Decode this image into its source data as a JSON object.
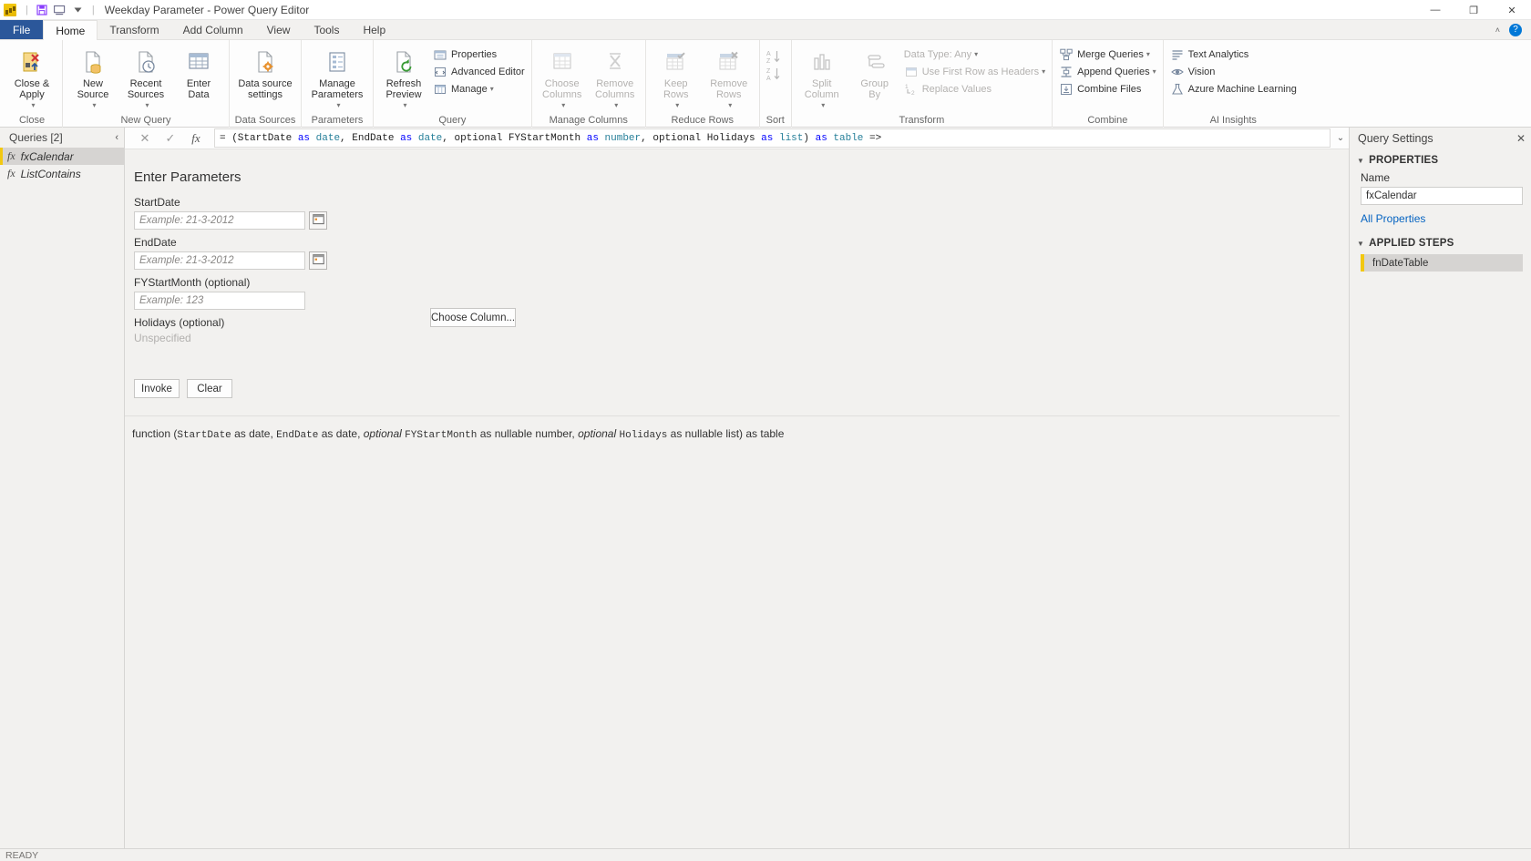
{
  "window": {
    "title": "Weekday Parameter - Power Query Editor",
    "minimize": "—",
    "maximize": "❐",
    "close": "✕",
    "qat_save": "save-icon",
    "qat_undo": "undo-icon",
    "qat_dropdown": "chevron-down-icon"
  },
  "tabs": [
    {
      "label": "File"
    },
    {
      "label": "Home"
    },
    {
      "label": "Transform"
    },
    {
      "label": "Add Column"
    },
    {
      "label": "View"
    },
    {
      "label": "Tools"
    },
    {
      "label": "Help"
    }
  ],
  "ribbon": {
    "collapse_caret": "˄",
    "help_label": "?",
    "groups": [
      {
        "name": "Close",
        "buttons": [
          {
            "label": "Close &\nApply",
            "caret": "▾"
          }
        ]
      },
      {
        "name": "New Query",
        "buttons": [
          {
            "label": "New\nSource",
            "caret": "▾"
          },
          {
            "label": "Recent\nSources",
            "caret": "▾"
          },
          {
            "label": "Enter\nData",
            "caret": ""
          }
        ]
      },
      {
        "name": "Data Sources",
        "buttons": [
          {
            "label": "Data source\nsettings",
            "caret": ""
          }
        ]
      },
      {
        "name": "Parameters",
        "buttons": [
          {
            "label": "Manage\nParameters",
            "caret": "▾"
          }
        ]
      },
      {
        "name": "Query",
        "buttons": [
          {
            "label": "Refresh\nPreview",
            "caret": "▾"
          }
        ],
        "small": [
          {
            "label": "Properties",
            "caret": ""
          },
          {
            "label": "Advanced Editor",
            "caret": ""
          },
          {
            "label": "Manage",
            "caret": "▾"
          }
        ]
      },
      {
        "name": "Manage Columns",
        "buttons": [
          {
            "label": "Choose\nColumns",
            "caret": "▾"
          },
          {
            "label": "Remove\nColumns",
            "caret": "▾"
          }
        ]
      },
      {
        "name": "Reduce Rows",
        "buttons": [
          {
            "label": "Keep\nRows",
            "caret": "▾"
          },
          {
            "label": "Remove\nRows",
            "caret": "▾"
          }
        ]
      },
      {
        "name": "Sort",
        "buttons": []
      },
      {
        "name": "Transform",
        "buttons": [
          {
            "label": "Split\nColumn",
            "caret": "▾"
          },
          {
            "label": "Group\nBy",
            "caret": ""
          }
        ],
        "small": [
          {
            "label": "Data Type: Any",
            "caret": "▾"
          },
          {
            "label": "Use First Row as Headers",
            "caret": "▾"
          },
          {
            "label": "Replace Values",
            "caret": ""
          }
        ]
      },
      {
        "name": "Combine",
        "small": [
          {
            "label": "Merge Queries",
            "caret": "▾"
          },
          {
            "label": "Append Queries",
            "caret": "▾"
          },
          {
            "label": "Combine Files",
            "caret": ""
          }
        ]
      },
      {
        "name": "AI Insights",
        "small": [
          {
            "label": "Text Analytics",
            "caret": ""
          },
          {
            "label": "Vision",
            "caret": ""
          },
          {
            "label": "Azure Machine Learning",
            "caret": ""
          }
        ]
      }
    ]
  },
  "queries": {
    "header": "Queries [2]",
    "collapse_icon": "‹",
    "items": [
      {
        "label": "fxCalendar",
        "icon": "fx"
      },
      {
        "label": "ListContains",
        "icon": "fx"
      }
    ]
  },
  "formula_bar": {
    "cancel_icon": "✕",
    "commit_icon": "✓",
    "fx_icon": "fx",
    "expand_icon": "⌄",
    "prefix": "= (StartDate ",
    "segments": [
      {
        "t": "= (StartDate ",
        "c": "plain"
      },
      {
        "t": "as",
        "c": "kw"
      },
      {
        "t": " ",
        "c": "plain"
      },
      {
        "t": "date",
        "c": "ty"
      },
      {
        "t": ", EndDate ",
        "c": "plain"
      },
      {
        "t": "as",
        "c": "kw"
      },
      {
        "t": " ",
        "c": "plain"
      },
      {
        "t": "date",
        "c": "ty"
      },
      {
        "t": ", optional FYStartMonth ",
        "c": "plain"
      },
      {
        "t": "as",
        "c": "kw"
      },
      {
        "t": " ",
        "c": "plain"
      },
      {
        "t": "number",
        "c": "ty"
      },
      {
        "t": ", optional Holidays ",
        "c": "plain"
      },
      {
        "t": "as",
        "c": "kw"
      },
      {
        "t": " ",
        "c": "plain"
      },
      {
        "t": "list",
        "c": "ty"
      },
      {
        "t": ") ",
        "c": "plain"
      },
      {
        "t": "as",
        "c": "kw"
      },
      {
        "t": " ",
        "c": "plain"
      },
      {
        "t": "table",
        "c": "ty"
      },
      {
        "t": " =>",
        "c": "plain"
      }
    ]
  },
  "invoke_form": {
    "title": "Enter Parameters",
    "fields": [
      {
        "label": "StartDate",
        "placeholder": "Example: 21-3-2012",
        "has_calendar": true
      },
      {
        "label": "EndDate",
        "placeholder": "Example: 21-3-2012",
        "has_calendar": true
      },
      {
        "label": "FYStartMonth (optional)",
        "placeholder": "Example: 123",
        "has_calendar": false
      }
    ],
    "holidays_label": "Holidays (optional)",
    "holidays_value": "Unspecified",
    "choose_column_button": "Choose Column...",
    "invoke_button": "Invoke",
    "clear_button": "Clear",
    "signature": {
      "pre": "function (",
      "p1": "StartDate",
      "s1": " as date, ",
      "p2": "EndDate",
      "s2": " as date, ",
      "opt1": "optional",
      "p3": "FYStartMonth",
      "s3": " as nullable number, ",
      "opt2": "optional",
      "p4": "Holidays",
      "s4": " as nullable list) as table"
    }
  },
  "query_settings": {
    "title": "Query Settings",
    "close_icon": "✕",
    "properties_header": "PROPERTIES",
    "name_label": "Name",
    "name_value": "fxCalendar",
    "all_properties_link": "All Properties",
    "applied_steps_header": "APPLIED STEPS",
    "steps": [
      {
        "label": "fnDateTable"
      }
    ]
  },
  "status_bar": {
    "text": "READY"
  },
  "colors": {
    "file_tab": "#2b579a",
    "accent_yellow": "#f2c811",
    "link_blue": "#0563c1",
    "keyword_blue": "#0000ff",
    "type_teal": "#267f99"
  }
}
